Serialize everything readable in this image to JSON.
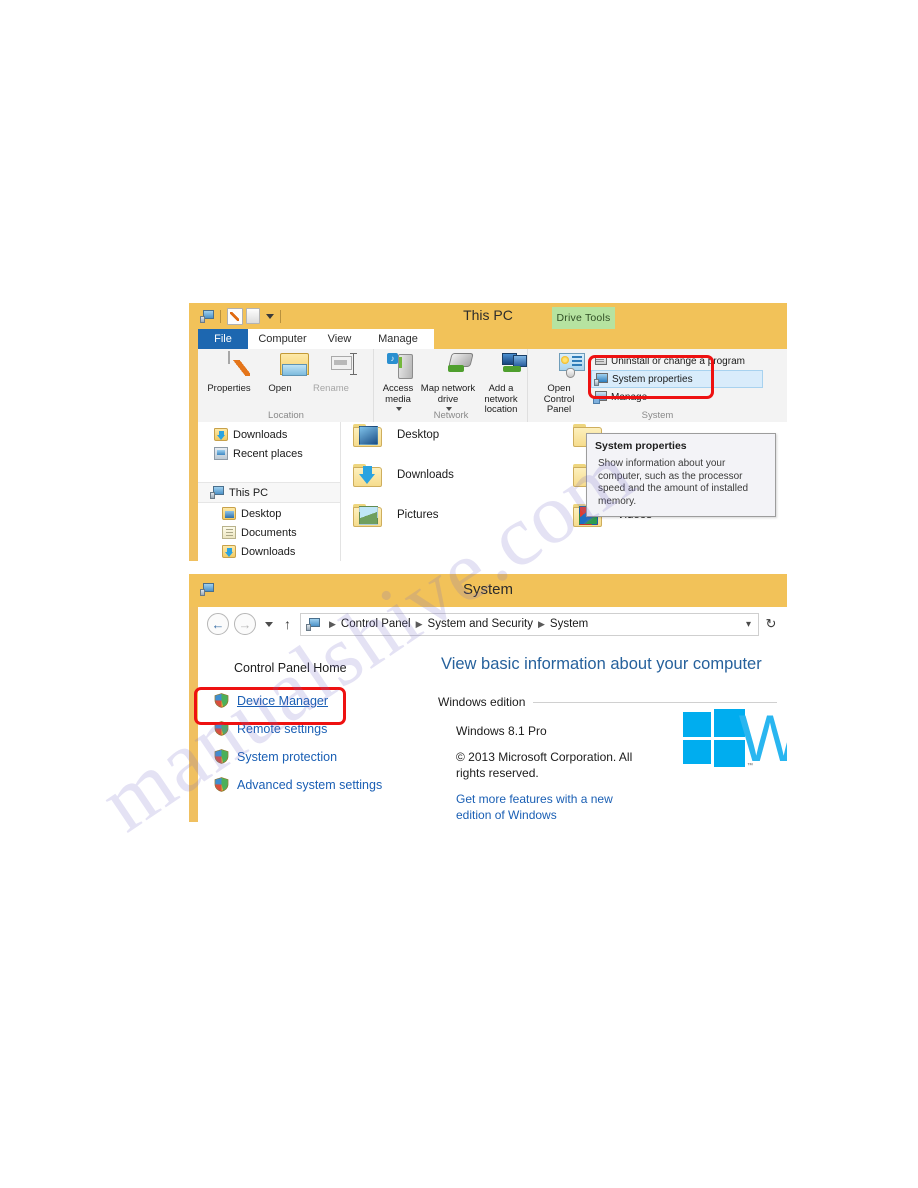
{
  "watermark": {
    "text": "manualshive.com"
  },
  "explorer_window": {
    "title": "This PC",
    "quick_access": {
      "pc_icon": "computer-icon",
      "properties_icon": "properties-document-icon",
      "folder_icon": "folder-icon",
      "dropdown_icon": "chevron-down-icon"
    },
    "contextual_tab": "Drive Tools",
    "tabs": [
      {
        "label": "File",
        "active": true
      },
      {
        "label": "Computer",
        "active": false
      },
      {
        "label": "View",
        "active": false
      },
      {
        "label": "Manage",
        "active": false
      }
    ],
    "ribbon": {
      "groups": [
        {
          "label": "Location",
          "buttons": [
            {
              "label": "Properties",
              "icon": "properties-icon",
              "disabled": false,
              "dropdown": false
            },
            {
              "label": "Open",
              "icon": "open-folder-icon",
              "disabled": false,
              "dropdown": false
            },
            {
              "label": "Rename",
              "icon": "rename-icon",
              "disabled": true,
              "dropdown": false
            }
          ]
        },
        {
          "label": "Network",
          "buttons": [
            {
              "label": "Access media",
              "icon": "access-media-icon",
              "disabled": false,
              "dropdown": true
            },
            {
              "label": "Map network drive",
              "icon": "map-network-drive-icon",
              "disabled": false,
              "dropdown": true
            },
            {
              "label": "Add a network location",
              "icon": "add-network-location-icon",
              "disabled": false,
              "dropdown": false
            }
          ]
        },
        {
          "label": "System",
          "buttons": [
            {
              "label": "Open Control Panel",
              "icon": "control-panel-icon",
              "disabled": false,
              "dropdown": false
            }
          ],
          "list_items": [
            {
              "label": "Uninstall or change a program",
              "icon": "uninstall-program-icon",
              "selected": false
            },
            {
              "label": "System properties",
              "icon": "system-properties-icon",
              "selected": true
            },
            {
              "label": "Manage",
              "icon": "manage-icon",
              "selected": false
            }
          ]
        }
      ]
    },
    "nav_pane": [
      {
        "label": "Downloads",
        "icon": "downloads-folder-icon",
        "indent": 16,
        "selected": false
      },
      {
        "label": "Recent places",
        "icon": "recent-places-icon",
        "indent": 16,
        "selected": false
      },
      {
        "label": "This PC",
        "icon": "this-pc-icon",
        "indent": 12,
        "selected": true
      },
      {
        "label": "Desktop",
        "icon": "desktop-folder-icon",
        "indent": 24,
        "selected": false
      },
      {
        "label": "Documents",
        "icon": "documents-folder-icon",
        "indent": 24,
        "selected": false
      },
      {
        "label": "Downloads",
        "icon": "downloads-folder-icon",
        "indent": 24,
        "selected": false
      }
    ],
    "file_items": [
      {
        "label": "Desktop",
        "icon": "desktop-folder-icon",
        "col": 0,
        "row": 0
      },
      {
        "label": "Downloads",
        "icon": "downloads-folder-icon",
        "col": 0,
        "row": 1
      },
      {
        "label": "Pictures",
        "icon": "pictures-folder-icon",
        "col": 0,
        "row": 2
      },
      {
        "label": "Videos",
        "icon": "videos-folder-icon",
        "col": 1,
        "row": 2
      }
    ]
  },
  "tooltip": {
    "title": "System properties",
    "body": "Show information about your computer, such as the processor speed and the amount of installed memory."
  },
  "system_window": {
    "title": "System",
    "window_icon": "system-properties-icon",
    "toolbar": {
      "back_icon": "back-arrow-icon",
      "forward_icon": "forward-arrow-icon",
      "recent_icon": "chevron-down-icon",
      "up_icon": "up-arrow-icon",
      "refresh_icon": "refresh-icon",
      "address_dropdown_icon": "chevron-down-icon"
    },
    "breadcrumb": [
      "Control Panel",
      "System and Security",
      "System"
    ],
    "sidebar": {
      "home_label": "Control Panel Home",
      "links": [
        {
          "label": "Device Manager",
          "icon": "shield-icon",
          "highlighted": true
        },
        {
          "label": "Remote settings",
          "icon": "shield-icon",
          "highlighted": false
        },
        {
          "label": "System protection",
          "icon": "shield-icon",
          "highlighted": false
        },
        {
          "label": "Advanced system settings",
          "icon": "shield-icon",
          "highlighted": false
        }
      ]
    },
    "content": {
      "heading": "View basic information about your computer",
      "section_title": "Windows edition",
      "edition": "Windows 8.1 Pro",
      "copyright_line1": "© 2013 Microsoft Corporation. All",
      "copyright_line2": "rights reserved.",
      "upgrade_link_line1": "Get more features with a new",
      "upgrade_link_line2": "edition of Windows",
      "logo_trademark": "™",
      "logo_letter": "W"
    }
  },
  "colors": {
    "titlebar": "#f2c259",
    "contextual_tab": "#b6e3a0",
    "file_tab": "#1d67b0",
    "highlight_red": "#ee1111",
    "link_blue": "#1a5fb4",
    "heading_blue": "#26619c",
    "windows_logo": "#00adef"
  }
}
